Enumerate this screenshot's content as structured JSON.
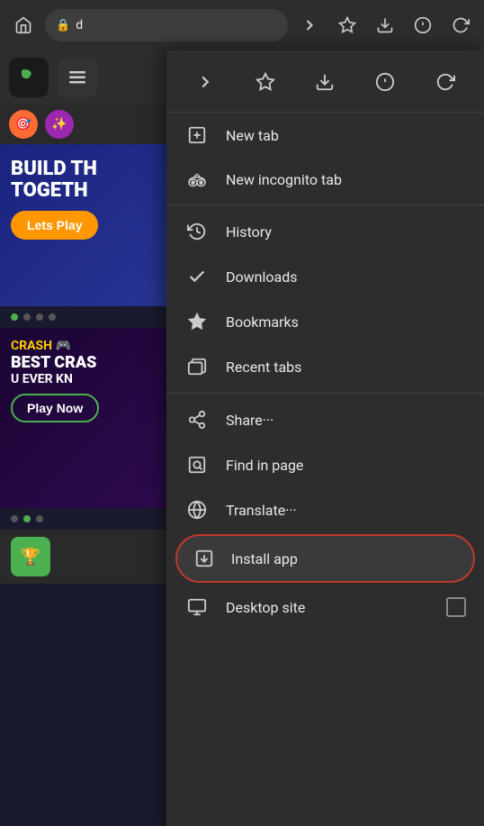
{
  "browser": {
    "address_text": "d",
    "lock_icon": "🔒"
  },
  "page": {
    "banner1": {
      "line1": "BUILD TH",
      "line2": "TOGETH",
      "button_label": "Lets Play"
    },
    "dots": [
      {
        "active": true
      },
      {
        "active": false
      },
      {
        "active": false
      },
      {
        "active": false
      }
    ],
    "banner2": {
      "tag": "CRASH 🎮",
      "line1": "BEST CRAS",
      "line2": "U EVER KN",
      "button_label": "Play Now"
    }
  },
  "dropdown": {
    "nav_icons": [
      "→",
      "☆",
      "⬇",
      "ⓘ",
      "↻"
    ],
    "items": [
      {
        "icon": "⊕",
        "label": "New tab",
        "divider_after": false
      },
      {
        "icon": "👓",
        "label": "New incognito tab",
        "divider_after": true
      },
      {
        "icon": "🕐",
        "label": "History",
        "divider_after": false
      },
      {
        "icon": "✔",
        "label": "Downloads",
        "divider_after": false
      },
      {
        "icon": "★",
        "label": "Bookmarks",
        "divider_after": false
      },
      {
        "icon": "⧉",
        "label": "Recent tabs",
        "divider_after": true
      },
      {
        "icon": "⋯",
        "label": "Share···",
        "divider_after": false
      },
      {
        "icon": "🔍",
        "label": "Find in page",
        "divider_after": false
      },
      {
        "icon": "G",
        "label": "Translate···",
        "divider_after": false
      }
    ],
    "install_app": {
      "icon": "⤴",
      "label": "Install app"
    },
    "desktop_site": {
      "icon": "🖥",
      "label": "Desktop site"
    }
  }
}
